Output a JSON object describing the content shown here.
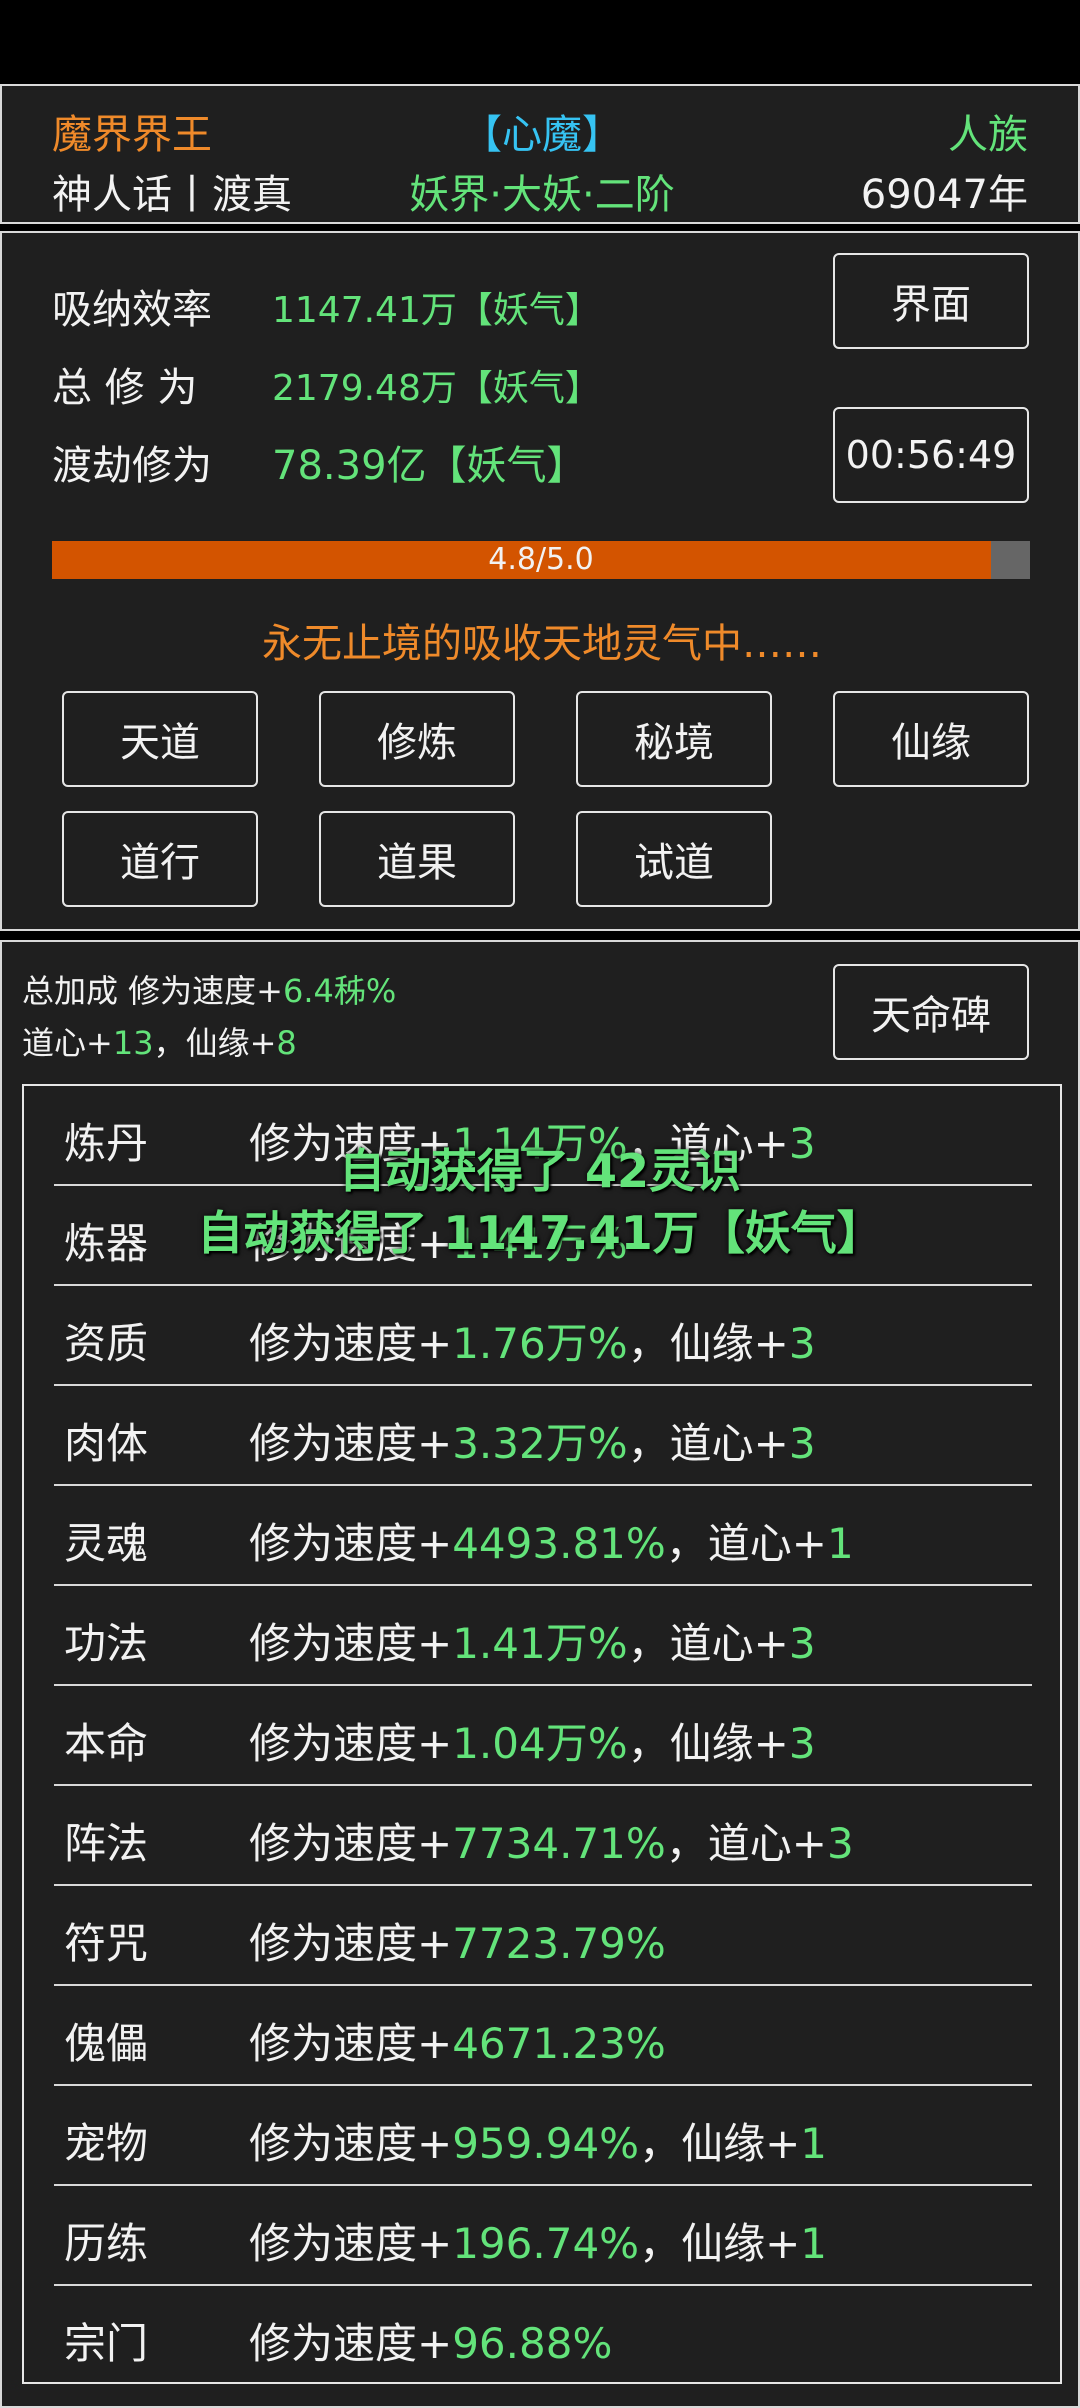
{
  "header": {
    "title_left": "魔界界王",
    "title_center": "【心魔】",
    "title_right": "人族",
    "sub_left": "神人话丨渡真",
    "sub_center": "妖界·大妖·二阶",
    "sub_right": "69047年"
  },
  "stats": {
    "efficiency_label": "吸纳效率",
    "efficiency_value": "1147.41万【妖气】",
    "total_label": "总 修 为",
    "total_value": "2179.48万【妖气】",
    "tribulation_label": "渡劫修为",
    "tribulation_value": "78.39亿【妖气】"
  },
  "buttons": {
    "jiemian": "界面",
    "timer": "00:56:49",
    "tianming": "天命碑",
    "grid": [
      "天道",
      "修炼",
      "秘境",
      "仙缘",
      "道行",
      "道果",
      "试道"
    ]
  },
  "progress": {
    "text": "4.8/5.0",
    "fraction": 0.96,
    "fill_color": "#d35400"
  },
  "status_line": "永无止境的吸收天地灵气中……",
  "bonus": {
    "prefix": "总加成 修为速度+",
    "speed": "6.4秭%",
    "daoxin_label": "道心+",
    "daoxin": "13",
    "sep": "，",
    "xianyuan_label": "仙缘+",
    "xianyuan": "8"
  },
  "table": [
    {
      "name": "炼丹",
      "pre": "修为速度+",
      "val": "1.14万%",
      "mid": "，道心+",
      "num": "3"
    },
    {
      "name": "炼器",
      "pre": "修为速度+",
      "val": "1.41万%",
      "mid": "",
      "num": ""
    },
    {
      "name": "资质",
      "pre": "修为速度+",
      "val": "1.76万%",
      "mid": "，仙缘+",
      "num": "3"
    },
    {
      "name": "肉体",
      "pre": "修为速度+",
      "val": "3.32万%",
      "mid": "，道心+",
      "num": "3"
    },
    {
      "name": "灵魂",
      "pre": "修为速度+",
      "val": "4493.81%",
      "mid": "，道心+",
      "num": "1"
    },
    {
      "name": "功法",
      "pre": "修为速度+",
      "val": "1.41万%",
      "mid": "，道心+",
      "num": "3"
    },
    {
      "name": "本命",
      "pre": "修为速度+",
      "val": "1.04万%",
      "mid": "，仙缘+",
      "num": "3"
    },
    {
      "name": "阵法",
      "pre": "修为速度+",
      "val": "7734.71%",
      "mid": "，道心+",
      "num": "3"
    },
    {
      "name": "符咒",
      "pre": "修为速度+",
      "val": "7723.79%",
      "mid": "",
      "num": ""
    },
    {
      "name": "傀儡",
      "pre": "修为速度+",
      "val": "4671.23%",
      "mid": "",
      "num": ""
    },
    {
      "name": "宠物",
      "pre": "修为速度+",
      "val": "959.94%",
      "mid": "，仙缘+",
      "num": "1"
    },
    {
      "name": "历练",
      "pre": "修为速度+",
      "val": "196.74%",
      "mid": "，仙缘+",
      "num": "1"
    },
    {
      "name": "宗门",
      "pre": "修为速度+",
      "val": "96.88%",
      "mid": "",
      "num": ""
    }
  ],
  "toasts": [
    "自动获得了 42灵识",
    "自动获得了 1147.41万【妖气】"
  ],
  "colors": {
    "orange": "#ef8a2a",
    "cyan": "#36c3f2",
    "green": "#63e37a",
    "panel_bg": "#1f1f1f"
  }
}
